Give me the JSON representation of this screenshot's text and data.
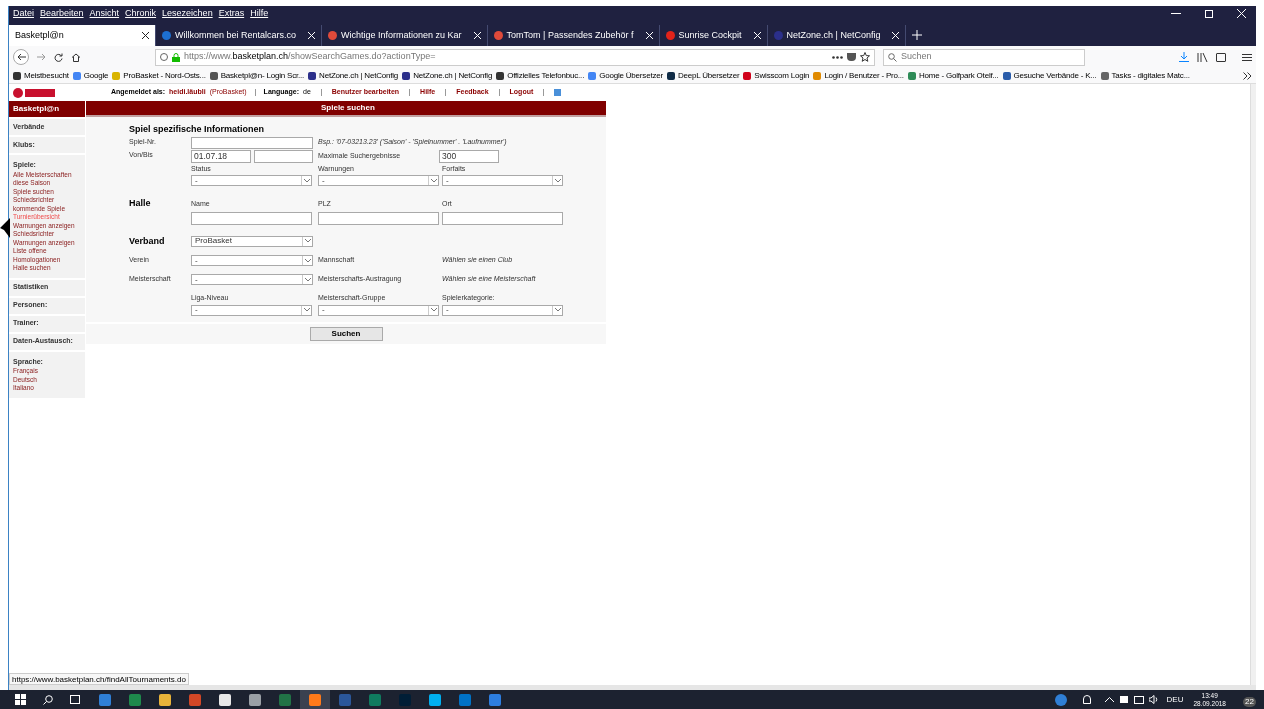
{
  "menu": [
    "Datei",
    "Bearbeiten",
    "Ansicht",
    "Chronik",
    "Lesezeichen",
    "Extras",
    "Hilfe"
  ],
  "tabs": [
    {
      "title": "Basketpl@n",
      "selected": true
    },
    {
      "title": "Willkommen bei Rentalcars.co",
      "selected": false,
      "color": "#1d6fd1"
    },
    {
      "title": "Wichtige Informationen zu Kar",
      "selected": false,
      "color": "#e04a3a"
    },
    {
      "title": "TomTom | Passendes Zubehör f",
      "selected": false,
      "color": "#e04a3a"
    },
    {
      "title": "Sunrise Cockpit",
      "selected": false,
      "color": "#e2231a"
    },
    {
      "title": "NetZone.ch | NetConfig",
      "selected": false,
      "color": "#2b2f8a"
    }
  ],
  "url": {
    "prefix": "https://www.",
    "domain": "basketplan.ch",
    "path": "/showSearchGames.do?actionType="
  },
  "search": {
    "placeholder": "Suchen"
  },
  "bookmarks": [
    {
      "label": "Meistbesucht",
      "color": "#333333"
    },
    {
      "label": "Google",
      "color": "#4285f4"
    },
    {
      "label": "ProBasket - Nord-Osts...",
      "color": "#d9b400"
    },
    {
      "label": "Basketpl@n- Login Scr...",
      "color": "#555555"
    },
    {
      "label": "NetZone.ch | NetConfig",
      "color": "#2b2f8a"
    },
    {
      "label": "NetZone.ch | NetConfig",
      "color": "#2b2f8a"
    },
    {
      "label": "Offizielles Telefonbuc...",
      "color": "#333333"
    },
    {
      "label": "Google Übersetzer",
      "color": "#4285f4"
    },
    {
      "label": "DeepL Übersetzer",
      "color": "#0f2b46"
    },
    {
      "label": "Swisscom Login",
      "color": "#d0021b"
    },
    {
      "label": "Login / Benutzer - Pro...",
      "color": "#e08a00"
    },
    {
      "label": "Home - Golfpark Otelf...",
      "color": "#2e8b57"
    },
    {
      "label": "Gesuche Verbände - K...",
      "color": "#2a5caa"
    },
    {
      "label": "Tasks - digitales Matc...",
      "color": "#666666"
    }
  ],
  "site": {
    "logged_label": "Angemeldet als:",
    "user": "heidi.läubli",
    "org": "(ProBasket)",
    "language_label": "Language:",
    "language": "de",
    "links": [
      "Benutzer bearbeiten",
      "Hilfe",
      "Feedback",
      "Logout"
    ],
    "brand": "Basketpl@n",
    "page_title": "Spiele suchen"
  },
  "sidebar": [
    {
      "title": "Verbände"
    },
    {
      "title": "Klubs:"
    },
    {
      "title": "Spiele:",
      "links": [
        {
          "label": "Alle Meisterschaften diese Saison",
          "selected": false
        },
        {
          "label": "Spiele suchen",
          "selected": false
        },
        {
          "label": "Schiedsrichter kommende Spiele",
          "selected": false
        },
        {
          "label": "Turnierübersicht",
          "selected": true
        },
        {
          "label": "Warnungen anzeigen",
          "selected": false
        },
        {
          "label": "Schiedsrichter Warnungen anzeigen",
          "selected": false
        },
        {
          "label": "Liste offene Homologationen",
          "selected": false
        },
        {
          "label": "Halle suchen",
          "selected": false
        }
      ]
    },
    {
      "title": "Statistiken"
    },
    {
      "title": "Personen:"
    },
    {
      "title": "Trainer:"
    },
    {
      "title": "Daten-Austausch:"
    },
    {
      "title": "Sprache:",
      "links": [
        {
          "label": "Français",
          "selected": false
        },
        {
          "label": "Deutsch",
          "selected": false
        },
        {
          "label": "Italiano",
          "selected": false
        }
      ]
    }
  ],
  "form": {
    "section1": "Spiel spezifische Informationen",
    "game_no_label": "Spiel-Nr.",
    "game_no_hint": "Bsp.: '07-03213.23' ('Saison' - 'Spielnummer' . 'Laufnummer')",
    "date_label": "Von/Bis",
    "date_from": "01.07.18",
    "max_label": "Maximale Suchergebnisse",
    "max_value": "300",
    "select_row1": [
      {
        "label": "Status",
        "value": "-"
      },
      {
        "label": "Warnungen",
        "value": "-"
      },
      {
        "label": "Forfaits",
        "value": "-"
      }
    ],
    "section2": "Halle",
    "hall_fields": [
      "Name",
      "PLZ",
      "Ort"
    ],
    "section3": "Verband",
    "verband_value": "ProBasket",
    "verein_label": "Verein",
    "verein_value": "-",
    "mannschaft_label": "Mannschaft",
    "mannschaft_hint": "Wählen sie einen Club",
    "meister_label": "Meisterschaft",
    "meister_value": "-",
    "austragung_label": "Meisterschafts-Austragung",
    "austragung_hint": "Wählen sie eine Meisterschaft",
    "select_row2": [
      {
        "label": "Liga-Niveau",
        "value": "-"
      },
      {
        "label": "Meisterschaft-Gruppe",
        "value": "-"
      },
      {
        "label": "Spielerkategorie:",
        "value": "-"
      }
    ],
    "submit": "Suchen"
  },
  "status_url": "https://www.basketplan.ch/findAllTournaments.do",
  "taskbar": [
    {
      "color": "#2f7fd6",
      "selected": false
    },
    {
      "color": "#1e8a4c",
      "selected": false
    },
    {
      "color": "#e8b33a",
      "selected": false
    },
    {
      "color": "#d24726",
      "selected": false
    },
    {
      "color": "#e8e8e8",
      "selected": false
    },
    {
      "color": "#9aa0a6",
      "selected": false
    },
    {
      "color": "#217346",
      "selected": false
    },
    {
      "color": "#ff7a1a",
      "selected": true
    },
    {
      "color": "#2b579a",
      "selected": false
    },
    {
      "color": "#0f7b5f",
      "selected": false
    },
    {
      "color": "#001e36",
      "selected": false
    },
    {
      "color": "#00aff0",
      "selected": false
    },
    {
      "color": "#0072c6",
      "selected": false
    },
    {
      "color": "#2d7ee0",
      "selected": false
    }
  ],
  "tray": {
    "language": "DEU",
    "time": "13:49",
    "date": "28.09.2018",
    "notifications": "22"
  }
}
